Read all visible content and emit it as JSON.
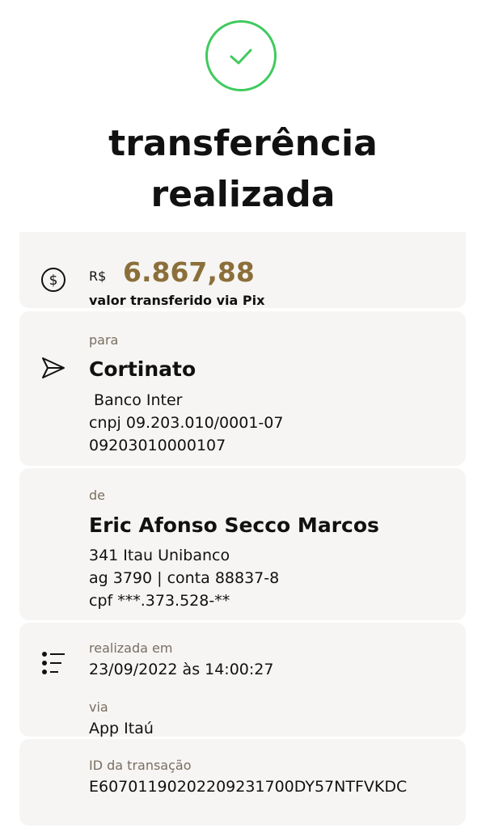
{
  "header": {
    "title_line1": "transferência",
    "title_line2": "realizada",
    "icon": "check-circle-icon",
    "accent_color": "#3fca5e"
  },
  "amount": {
    "currency": "R$",
    "value": "6.867,88",
    "description": "valor transferido via Pix",
    "icon": "dollar-circle-icon",
    "value_color": "#8b6f3a"
  },
  "recipient": {
    "label": "para",
    "name": "Cortinato",
    "bank": " Banco Inter",
    "document": "cnpj 09.203.010/0001-07",
    "account": "09203010000107",
    "icon": "send-icon"
  },
  "sender": {
    "label": "de",
    "name": "Eric Afonso Secco Marcos",
    "bank": "341 Itau Unibanco",
    "account": "ag 3790 | conta 88837-8",
    "document": "cpf ***.373.528-**"
  },
  "details": {
    "icon": "list-icon",
    "date_label": "realizada em",
    "date_value": "23/09/2022 às 14:00:27",
    "via_label": "via",
    "via_value": "App Itaú",
    "id_label": "ID da transação",
    "id_value": "E60701190202209231700DY57NTFVKDC"
  }
}
